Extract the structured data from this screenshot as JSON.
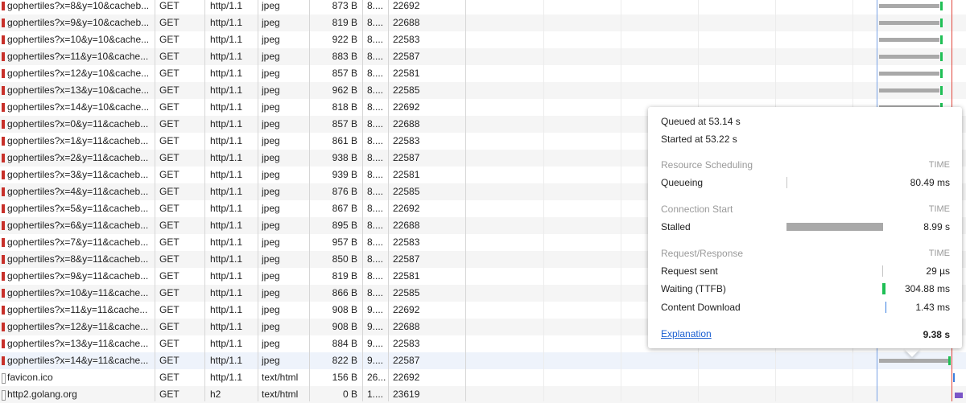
{
  "rows": [
    {
      "name": "gophertiles?x=8&y=10&cacheb...",
      "method": "GET",
      "protocol": "http/1.1",
      "type": "jpeg",
      "size": "873 B",
      "time": "8....",
      "conn": "22692"
    },
    {
      "name": "gophertiles?x=9&y=10&cacheb...",
      "method": "GET",
      "protocol": "http/1.1",
      "type": "jpeg",
      "size": "819 B",
      "time": "8....",
      "conn": "22688"
    },
    {
      "name": "gophertiles?x=10&y=10&cache...",
      "method": "GET",
      "protocol": "http/1.1",
      "type": "jpeg",
      "size": "922 B",
      "time": "8....",
      "conn": "22583"
    },
    {
      "name": "gophertiles?x=11&y=10&cache...",
      "method": "GET",
      "protocol": "http/1.1",
      "type": "jpeg",
      "size": "883 B",
      "time": "8....",
      "conn": "22587"
    },
    {
      "name": "gophertiles?x=12&y=10&cache...",
      "method": "GET",
      "protocol": "http/1.1",
      "type": "jpeg",
      "size": "857 B",
      "time": "8....",
      "conn": "22581"
    },
    {
      "name": "gophertiles?x=13&y=10&cache...",
      "method": "GET",
      "protocol": "http/1.1",
      "type": "jpeg",
      "size": "962 B",
      "time": "8....",
      "conn": "22585"
    },
    {
      "name": "gophertiles?x=14&y=10&cache...",
      "method": "GET",
      "protocol": "http/1.1",
      "type": "jpeg",
      "size": "818 B",
      "time": "8....",
      "conn": "22692"
    },
    {
      "name": "gophertiles?x=0&y=11&cacheb...",
      "method": "GET",
      "protocol": "http/1.1",
      "type": "jpeg",
      "size": "857 B",
      "time": "8....",
      "conn": "22688"
    },
    {
      "name": "gophertiles?x=1&y=11&cacheb...",
      "method": "GET",
      "protocol": "http/1.1",
      "type": "jpeg",
      "size": "861 B",
      "time": "8....",
      "conn": "22583"
    },
    {
      "name": "gophertiles?x=2&y=11&cacheb...",
      "method": "GET",
      "protocol": "http/1.1",
      "type": "jpeg",
      "size": "938 B",
      "time": "8....",
      "conn": "22587"
    },
    {
      "name": "gophertiles?x=3&y=11&cacheb...",
      "method": "GET",
      "protocol": "http/1.1",
      "type": "jpeg",
      "size": "939 B",
      "time": "8....",
      "conn": "22581"
    },
    {
      "name": "gophertiles?x=4&y=11&cacheb...",
      "method": "GET",
      "protocol": "http/1.1",
      "type": "jpeg",
      "size": "876 B",
      "time": "8....",
      "conn": "22585"
    },
    {
      "name": "gophertiles?x=5&y=11&cacheb...",
      "method": "GET",
      "protocol": "http/1.1",
      "type": "jpeg",
      "size": "867 B",
      "time": "8....",
      "conn": "22692"
    },
    {
      "name": "gophertiles?x=6&y=11&cacheb...",
      "method": "GET",
      "protocol": "http/1.1",
      "type": "jpeg",
      "size": "895 B",
      "time": "8....",
      "conn": "22688"
    },
    {
      "name": "gophertiles?x=7&y=11&cacheb...",
      "method": "GET",
      "protocol": "http/1.1",
      "type": "jpeg",
      "size": "957 B",
      "time": "8....",
      "conn": "22583"
    },
    {
      "name": "gophertiles?x=8&y=11&cacheb...",
      "method": "GET",
      "protocol": "http/1.1",
      "type": "jpeg",
      "size": "850 B",
      "time": "8....",
      "conn": "22587"
    },
    {
      "name": "gophertiles?x=9&y=11&cacheb...",
      "method": "GET",
      "protocol": "http/1.1",
      "type": "jpeg",
      "size": "819 B",
      "time": "8....",
      "conn": "22581"
    },
    {
      "name": "gophertiles?x=10&y=11&cache...",
      "method": "GET",
      "protocol": "http/1.1",
      "type": "jpeg",
      "size": "866 B",
      "time": "8....",
      "conn": "22585"
    },
    {
      "name": "gophertiles?x=11&y=11&cache...",
      "method": "GET",
      "protocol": "http/1.1",
      "type": "jpeg",
      "size": "908 B",
      "time": "9....",
      "conn": "22692"
    },
    {
      "name": "gophertiles?x=12&y=11&cache...",
      "method": "GET",
      "protocol": "http/1.1",
      "type": "jpeg",
      "size": "908 B",
      "time": "9....",
      "conn": "22688"
    },
    {
      "name": "gophertiles?x=13&y=11&cache...",
      "method": "GET",
      "protocol": "http/1.1",
      "type": "jpeg",
      "size": "884 B",
      "time": "9....",
      "conn": "22583"
    },
    {
      "name": "gophertiles?x=14&y=11&cache...",
      "method": "GET",
      "protocol": "http/1.1",
      "type": "jpeg",
      "size": "822 B",
      "time": "9....",
      "conn": "22587"
    },
    {
      "name": "favicon.ico",
      "method": "GET",
      "protocol": "http/1.1",
      "type": "text/html",
      "size": "156 B",
      "time": "26...",
      "conn": "22692"
    },
    {
      "name": "http2.golang.org",
      "method": "GET",
      "protocol": "h2",
      "type": "text/html",
      "size": "0 B",
      "time": "1....",
      "conn": "23619"
    }
  ],
  "popup": {
    "queued": "Queued at 53.14 s",
    "started": "Started at 53.22 s",
    "time_header": "TIME",
    "sections": [
      {
        "title": "Resource Scheduling",
        "items": [
          {
            "label": "Queueing",
            "value": "80.49 ms"
          }
        ]
      },
      {
        "title": "Connection Start",
        "items": [
          {
            "label": "Stalled",
            "value": "8.99 s"
          }
        ]
      },
      {
        "title": "Request/Response",
        "items": [
          {
            "label": "Request sent",
            "value": "29 µs"
          },
          {
            "label": "Waiting (TTFB)",
            "value": "304.88 ms"
          },
          {
            "label": "Content Download",
            "value": "1.43 ms"
          }
        ]
      }
    ],
    "explanation": "Explanation",
    "total": "9.38 s"
  },
  "colors": {
    "stalled": "#a9a9a9",
    "waiting": "#1fbf55",
    "download": "#3a7fe0",
    "marker_blue": "#6a9ae0",
    "marker_red": "#e0453b"
  }
}
